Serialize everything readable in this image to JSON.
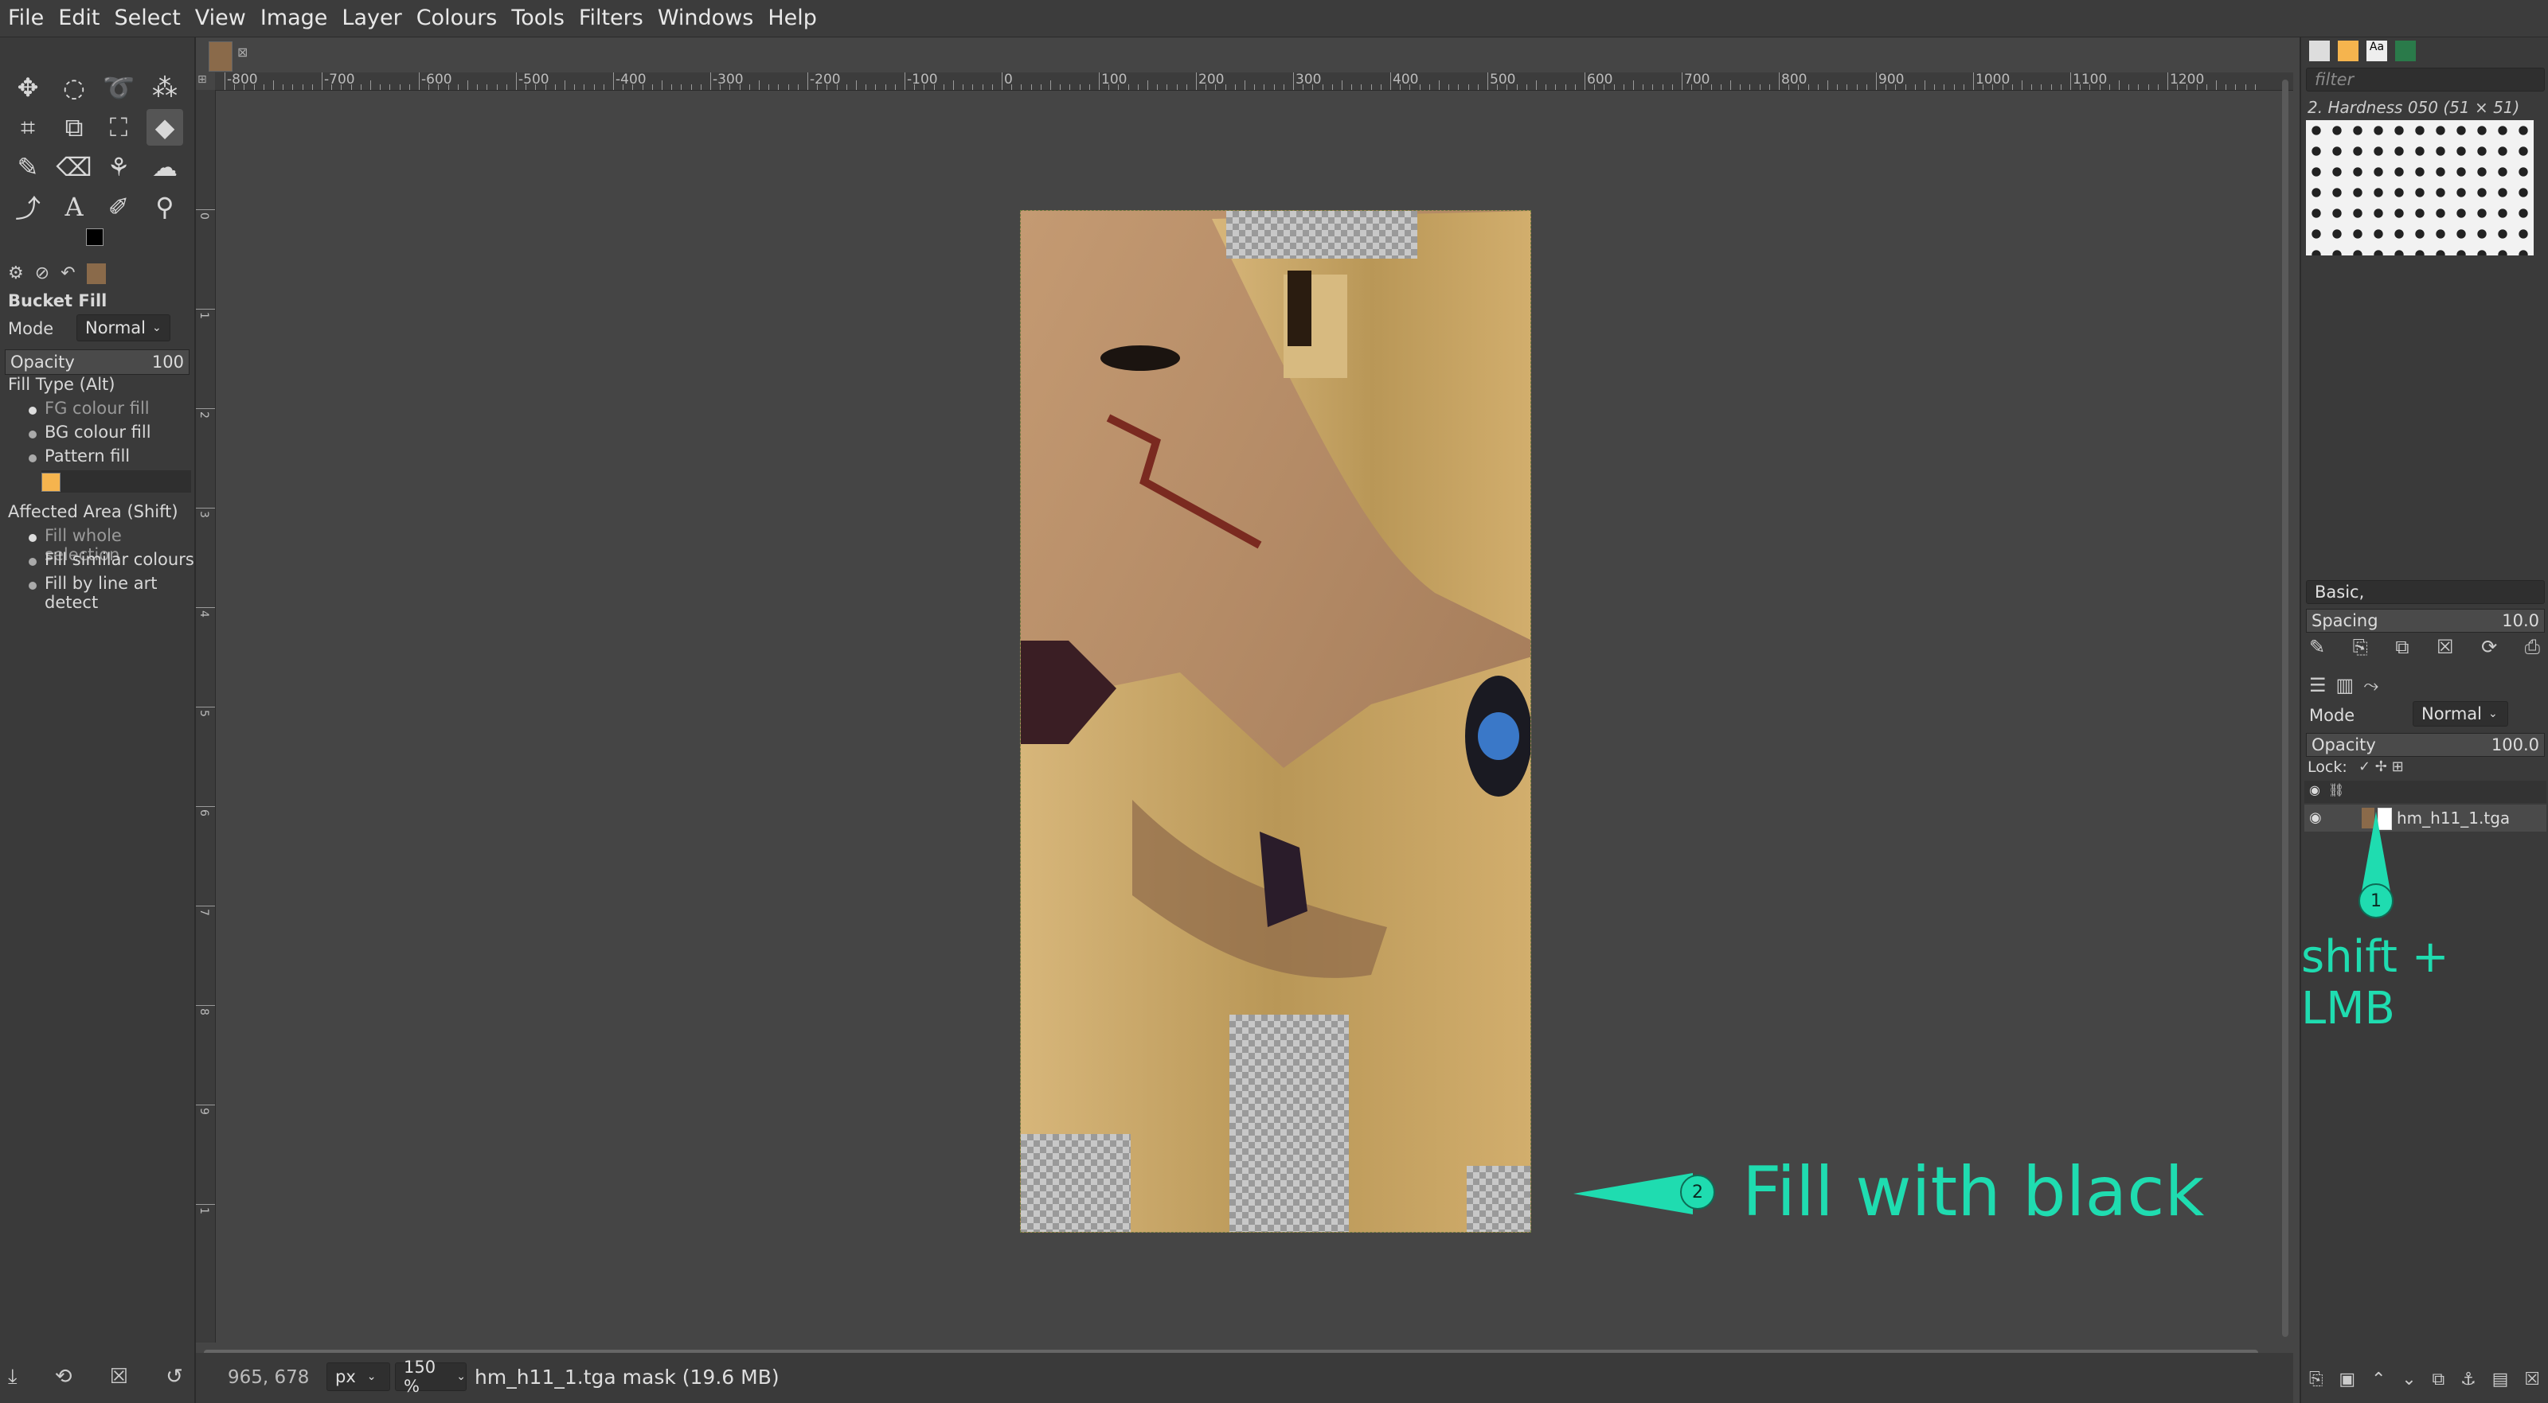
{
  "menu": [
    "File",
    "Edit",
    "Select",
    "View",
    "Image",
    "Layer",
    "Colours",
    "Tools",
    "Filters",
    "Windows",
    "Help"
  ],
  "tool_options": {
    "title": "Bucket Fill",
    "mode_label": "Mode",
    "mode_value": "Normal",
    "opacity_label": "Opacity",
    "opacity_value": "100",
    "fill_type_label": "Fill Type  (Alt)",
    "fill_types": [
      "FG colour fill",
      "BG colour fill",
      "Pattern fill"
    ],
    "affected_label": "Affected Area  (Shift)",
    "affected_options": [
      "Fill whole selection",
      "Fill similar colours",
      "Fill by line art detect"
    ]
  },
  "ruler": {
    "h_labels": [
      "-800",
      "-700",
      "-600",
      "-500",
      "-400",
      "-300",
      "-200",
      "-100",
      "0",
      "100",
      "200",
      "300",
      "400",
      "500",
      "600",
      "700",
      "800",
      "900",
      "1000",
      "1100",
      "1200"
    ],
    "v_labels": [
      "0",
      "1",
      "2",
      "3",
      "4",
      "5",
      "6",
      "7",
      "8",
      "9",
      "1"
    ]
  },
  "brushes": {
    "filter_placeholder": "filter",
    "current": "2. Hardness 050 (51 × 51)",
    "preset": "Basic,",
    "spacing_label": "Spacing",
    "spacing_value": "10.0"
  },
  "layers": {
    "mode_label": "Mode",
    "mode_value": "Normal",
    "opacity_label": "Opacity",
    "opacity_value": "100.0",
    "lock_label": "Lock:",
    "layer_name": "hm_h11_1.tga"
  },
  "status": {
    "coords": "965, 678",
    "unit": "px",
    "zoom": "150 %",
    "message": "hm_h11_1.tga mask (19.6 MB)"
  },
  "annotations": {
    "step1_number": "1",
    "step1_text": "shift + LMB",
    "step2_number": "2",
    "step2_text": "Fill with black"
  },
  "colors": {
    "accent": "#1fdcb0",
    "bg": "#454545",
    "dock": "#3a3a3a"
  }
}
